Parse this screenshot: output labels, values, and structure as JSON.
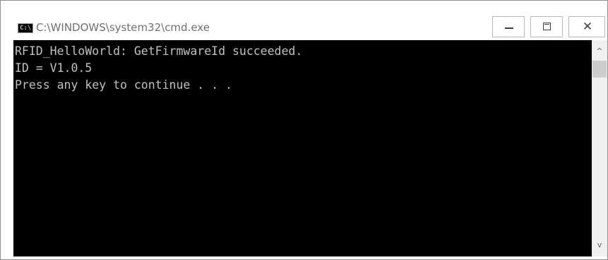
{
  "window": {
    "title": "C:\\WINDOWS\\system32\\cmd.exe",
    "icon_name": "cmd-icon",
    "icon_text": "C:\\."
  },
  "controls": {
    "minimize_icon": "minimize-icon",
    "maximize_icon": "maximize-icon",
    "close_icon": "close-icon",
    "close_glyph": "✕"
  },
  "console": {
    "lines": [
      "RFID_HelloWorld: GetFirmwareId succeeded.",
      "ID = V1.0.5",
      "Press any key to continue . . ."
    ],
    "background": "#000000",
    "foreground": "#c0c0c0"
  },
  "scrollbar": {
    "up_glyph": "^",
    "down_glyph": "v"
  }
}
